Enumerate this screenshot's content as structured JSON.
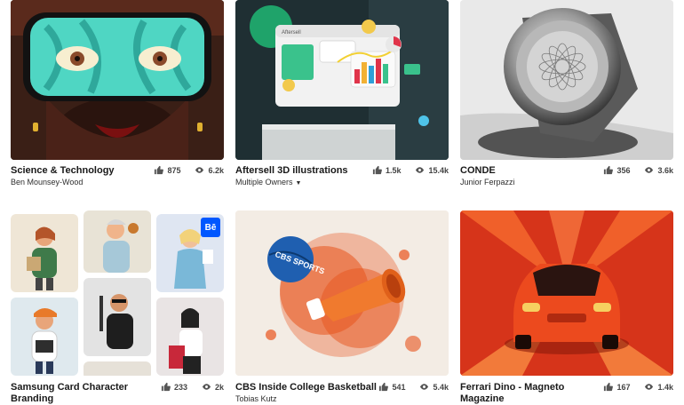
{
  "projects": [
    {
      "title": "Science & Technology",
      "owner": "Ben Mounsey-Wood",
      "appreciations": "875",
      "views": "6.2k"
    },
    {
      "title": "Aftersell 3D illustrations",
      "owner": "Multiple Owners",
      "appreciations": "1.5k",
      "views": "15.4k",
      "mockup_text": "Aftersell"
    },
    {
      "title": "CONDE",
      "owner": "Junior Ferpazzi",
      "appreciations": "356",
      "views": "3.6k"
    },
    {
      "title": "Samsung Card Character Branding",
      "owner": "",
      "appreciations": "233",
      "views": "2k",
      "badge": "Bē"
    },
    {
      "title": "CBS Inside College Basketball",
      "owner": "Tobias Kutz",
      "appreciations": "541",
      "views": "5.4k",
      "ball_text": "CBS SPORTS"
    },
    {
      "title": "Ferrari Dino - Magneto Magazine",
      "owner": "",
      "appreciations": "167",
      "views": "1.4k"
    }
  ],
  "icons": {
    "appreciate": "thumbs-up-icon",
    "views": "eye-icon",
    "owners_menu": "caret-down-icon"
  },
  "colors": {
    "text": "#191919",
    "muted": "#444444",
    "behance_blue": "#0057ff"
  }
}
